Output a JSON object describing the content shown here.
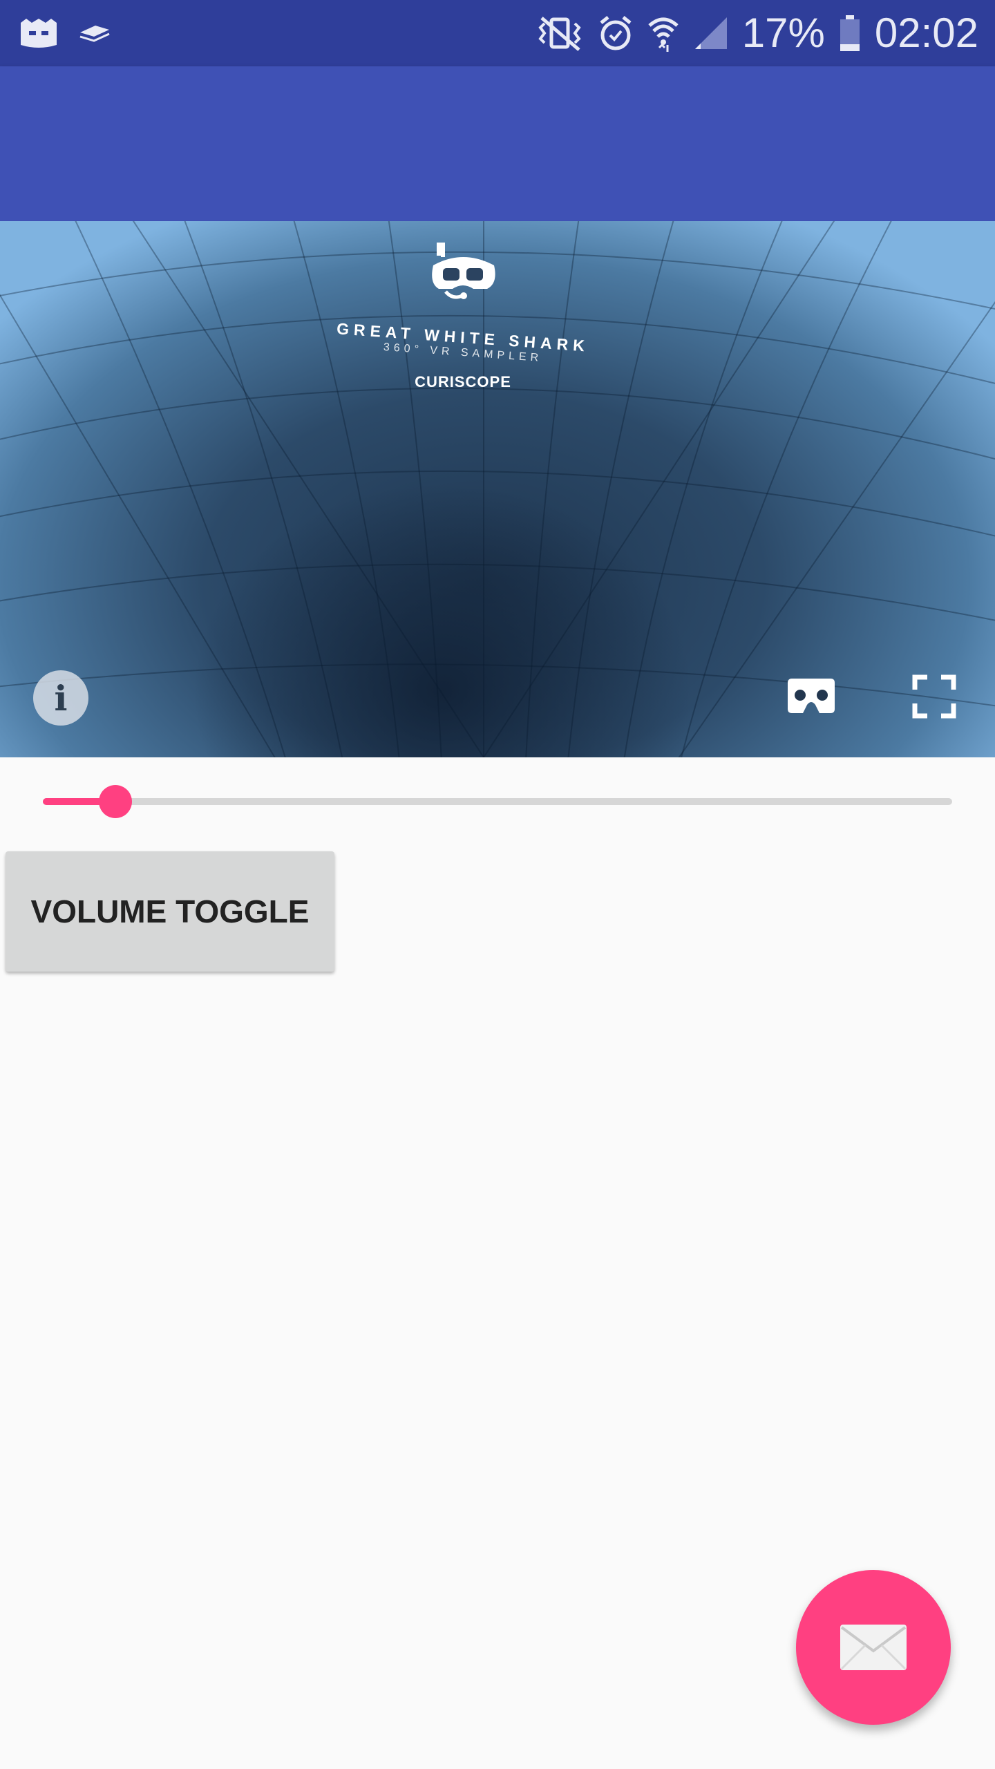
{
  "status_bar": {
    "battery_percent": "17%",
    "time": "02:02",
    "icons": [
      "app-notification-icon",
      "sync-notification-icon",
      "vibrate-off-icon",
      "alarm-icon",
      "wifi-icon",
      "signal-icon",
      "battery-icon"
    ]
  },
  "video": {
    "logo_title": "GREAT WHITE SHARK",
    "logo_subtitle": "360° VR SAMPLER",
    "logo_brand": "CURISCOPE",
    "controls": [
      "info-icon",
      "cardboard-vr-icon",
      "fullscreen-icon"
    ]
  },
  "slider": {
    "value_fraction": 0.08
  },
  "buttons": {
    "volume_toggle": "VOLUME TOGGLE"
  },
  "fab": {
    "icon": "email-icon"
  },
  "colors": {
    "status_bar": "#2f3e9a",
    "app_bar": "#3f51b5",
    "accent": "#ff4081",
    "background": "#fafafa"
  }
}
